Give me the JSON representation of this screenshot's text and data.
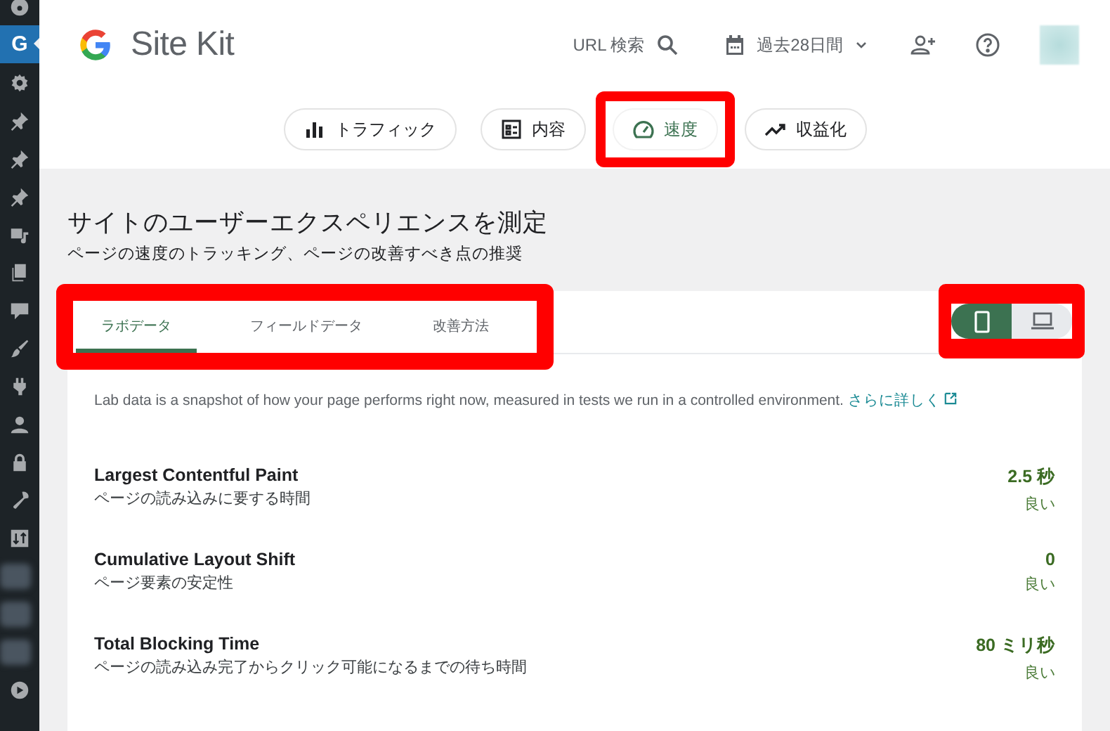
{
  "sidebar": {
    "items": [
      {
        "kind": "icon",
        "selected": false
      },
      {
        "kind": "letter",
        "label": "G",
        "selected": true
      },
      {
        "kind": "icon",
        "selected": false
      },
      {
        "kind": "icon",
        "selected": false
      },
      {
        "kind": "icon",
        "selected": false
      },
      {
        "kind": "icon",
        "selected": false
      },
      {
        "kind": "icon",
        "selected": false
      },
      {
        "kind": "icon",
        "selected": false
      },
      {
        "kind": "icon",
        "selected": false
      },
      {
        "kind": "icon",
        "selected": false
      },
      {
        "kind": "icon",
        "selected": false
      },
      {
        "kind": "icon",
        "selected": false
      },
      {
        "kind": "icon",
        "selected": false
      },
      {
        "kind": "icon",
        "selected": false
      },
      {
        "kind": "icon",
        "selected": false
      },
      {
        "kind": "blurred",
        "selected": false
      },
      {
        "kind": "blurred",
        "selected": false
      },
      {
        "kind": "blurred",
        "selected": false
      },
      {
        "kind": "icon",
        "selected": false
      }
    ]
  },
  "header": {
    "logo_text": "Site Kit",
    "url_search": "URL 検索",
    "date_range": "過去28日間"
  },
  "nav": [
    {
      "label": "トラフィック",
      "selected": false,
      "highlighted": false
    },
    {
      "label": "内容",
      "selected": false,
      "highlighted": false
    },
    {
      "label": "速度",
      "selected": true,
      "highlighted": true
    },
    {
      "label": "収益化",
      "selected": false,
      "highlighted": false
    }
  ],
  "page": {
    "title": "サイトのユーザーエクスペリエンスを測定",
    "subtitle": "ページの速度のトラッキング、ページの改善すべき点の推奨"
  },
  "tabs": {
    "highlighted": true,
    "items": [
      {
        "label": "ラボデータ",
        "selected": true
      },
      {
        "label": "フィールドデータ",
        "selected": false
      },
      {
        "label": "改善方法",
        "selected": false
      }
    ]
  },
  "device_toggle": {
    "highlighted": true,
    "items": [
      {
        "kind": "mobile",
        "selected": true
      },
      {
        "kind": "desktop",
        "selected": false
      }
    ]
  },
  "description": {
    "text": "Lab data is a snapshot of how your page performs right now, measured in tests we run in a controlled environment.",
    "link": "さらに詳しく"
  },
  "metrics": [
    {
      "name": "Largest Contentful Paint",
      "description": "ページの読み込みに要する時間",
      "value": "2.5 秒",
      "rating": "良い"
    },
    {
      "name": "Cumulative Layout Shift",
      "description": "ページ要素の安定性",
      "value": "0",
      "rating": "良い"
    },
    {
      "name": "Total Blocking Time",
      "description": "ページの読み込み完了からクリック可能になるまでの待ち時間",
      "value": "80 ミリ秒",
      "rating": "良い"
    }
  ]
}
